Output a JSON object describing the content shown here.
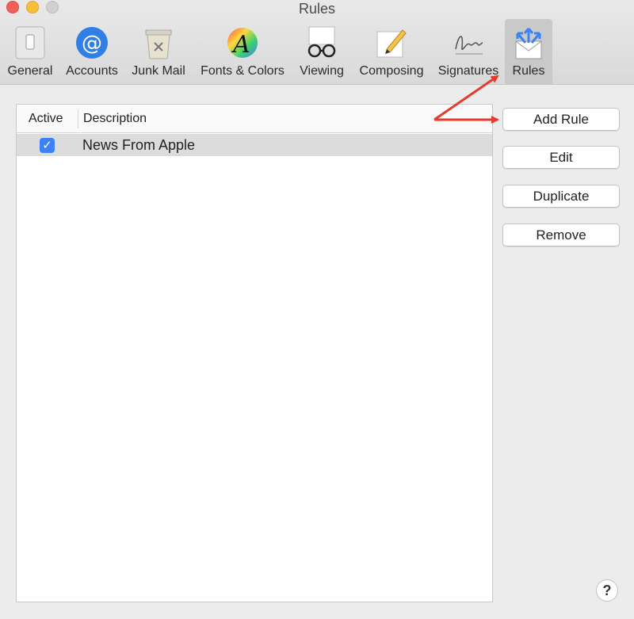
{
  "window": {
    "title": "Rules"
  },
  "toolbar": {
    "tabs": [
      {
        "label": "General",
        "icon": "switch-icon"
      },
      {
        "label": "Accounts",
        "icon": "at-sign-icon"
      },
      {
        "label": "Junk Mail",
        "icon": "trash-can-icon"
      },
      {
        "label": "Fonts & Colors",
        "icon": "color-wheel-icon"
      },
      {
        "label": "Viewing",
        "icon": "glasses-icon"
      },
      {
        "label": "Composing",
        "icon": "pencil-paper-icon"
      },
      {
        "label": "Signatures",
        "icon": "signature-icon"
      },
      {
        "label": "Rules",
        "icon": "envelope-arrows-icon",
        "selected": true
      }
    ]
  },
  "rules_table": {
    "columns": [
      "Active",
      "Description"
    ],
    "rows": [
      {
        "active": true,
        "description": "News From Apple"
      }
    ]
  },
  "buttons": {
    "add_rule": "Add Rule",
    "edit": "Edit",
    "duplicate": "Duplicate",
    "remove": "Remove",
    "help": "?"
  },
  "colors": {
    "accent": "#3b82f6",
    "annotation_arrow": "#e53b2c",
    "selected_tab": "#c9c9c9"
  }
}
